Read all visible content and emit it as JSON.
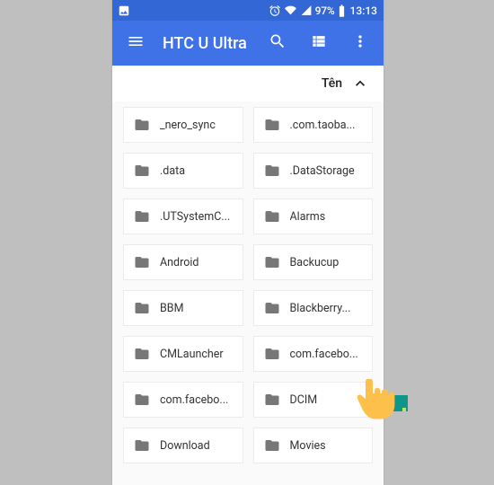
{
  "statusbar": {
    "battery_pct": "97%",
    "time": "13:13"
  },
  "appbar": {
    "title": "HTC U Ultra"
  },
  "sort": {
    "label": "Tên"
  },
  "folders": [
    {
      "name": "_nero_sync"
    },
    {
      "name": ".com.taoba..."
    },
    {
      "name": ".data"
    },
    {
      "name": ".DataStorage"
    },
    {
      "name": ".UTSystemC..."
    },
    {
      "name": "Alarms"
    },
    {
      "name": "Android"
    },
    {
      "name": "Backucup"
    },
    {
      "name": "BBM"
    },
    {
      "name": "Blackberry..."
    },
    {
      "name": "CMLauncher"
    },
    {
      "name": "com.facebo..."
    },
    {
      "name": "com.facebo..."
    },
    {
      "name": "DCIM"
    },
    {
      "name": "Download"
    },
    {
      "name": "Movies"
    }
  ]
}
